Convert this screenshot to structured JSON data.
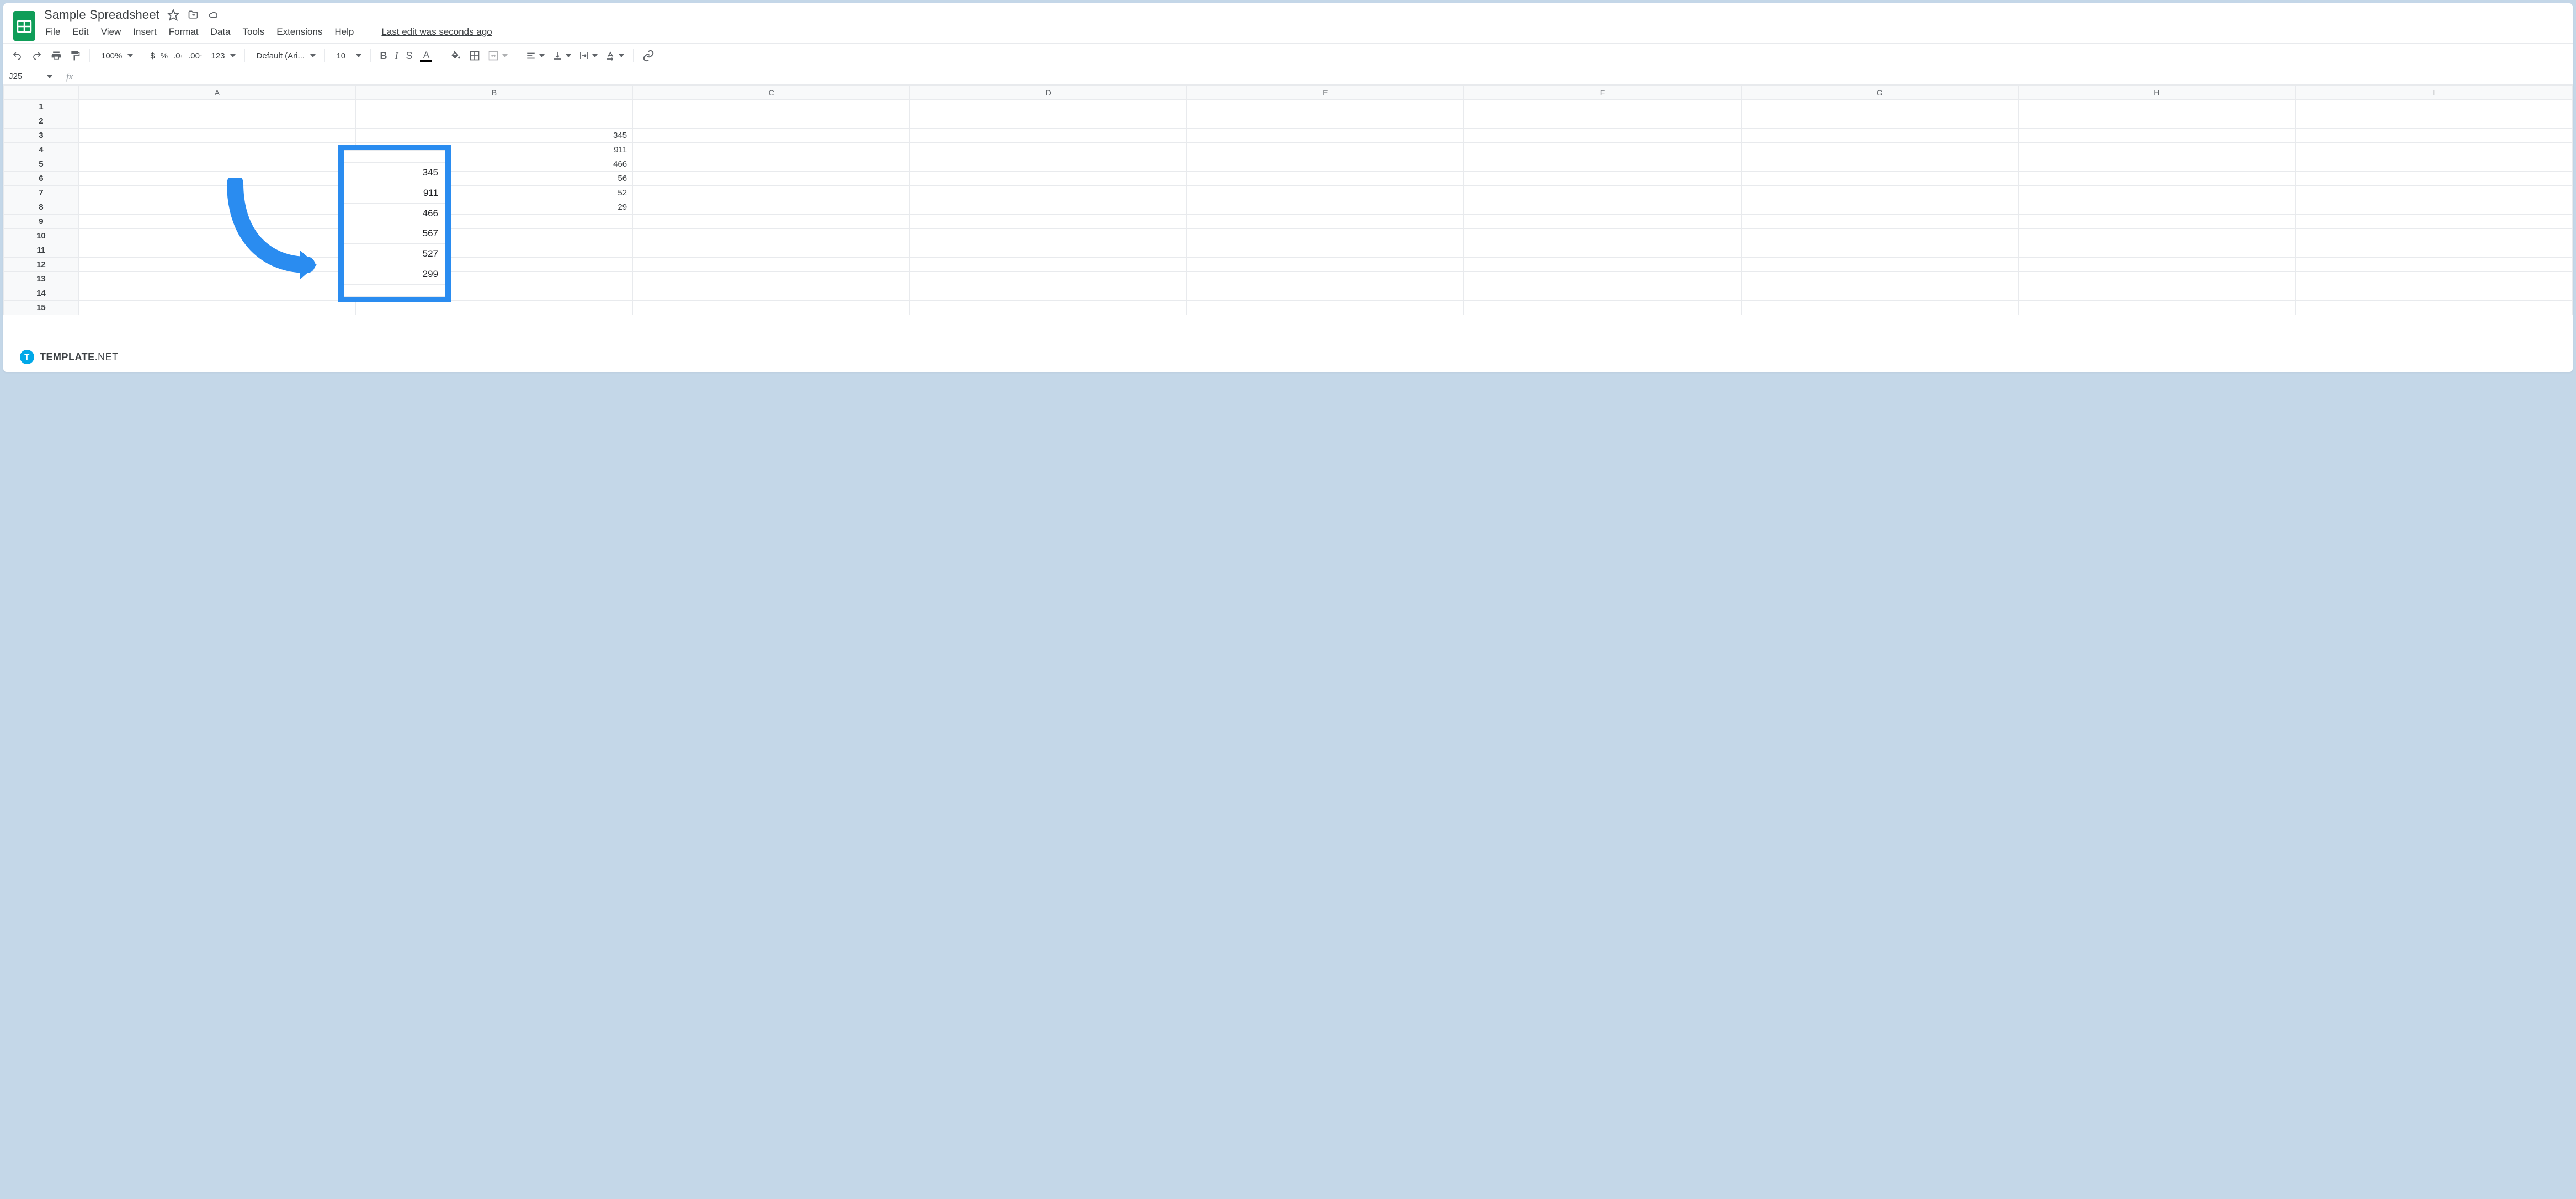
{
  "doc": {
    "title": "Sample Spreadsheet",
    "last_edit": "Last edit was seconds ago"
  },
  "menubar": [
    "File",
    "Edit",
    "View",
    "Insert",
    "Format",
    "Data",
    "Tools",
    "Extensions",
    "Help"
  ],
  "toolbar": {
    "zoom": "100%",
    "font": "Default (Ari...",
    "font_size": "10"
  },
  "namebox": "J25",
  "columns": [
    "A",
    "B",
    "C",
    "D",
    "E",
    "F",
    "G",
    "H",
    "I"
  ],
  "rows": 15,
  "cells": {
    "B3": "345",
    "B4": "911",
    "B5": "466",
    "B6": "56",
    "B7": "52",
    "B8": "29"
  },
  "callout": {
    "col": "D",
    "values": [
      "345",
      "911",
      "466",
      "567",
      "527",
      "299"
    ]
  },
  "watermark": {
    "brand": "TEMPLATE",
    "suffix": ".NET",
    "badge": "T"
  }
}
